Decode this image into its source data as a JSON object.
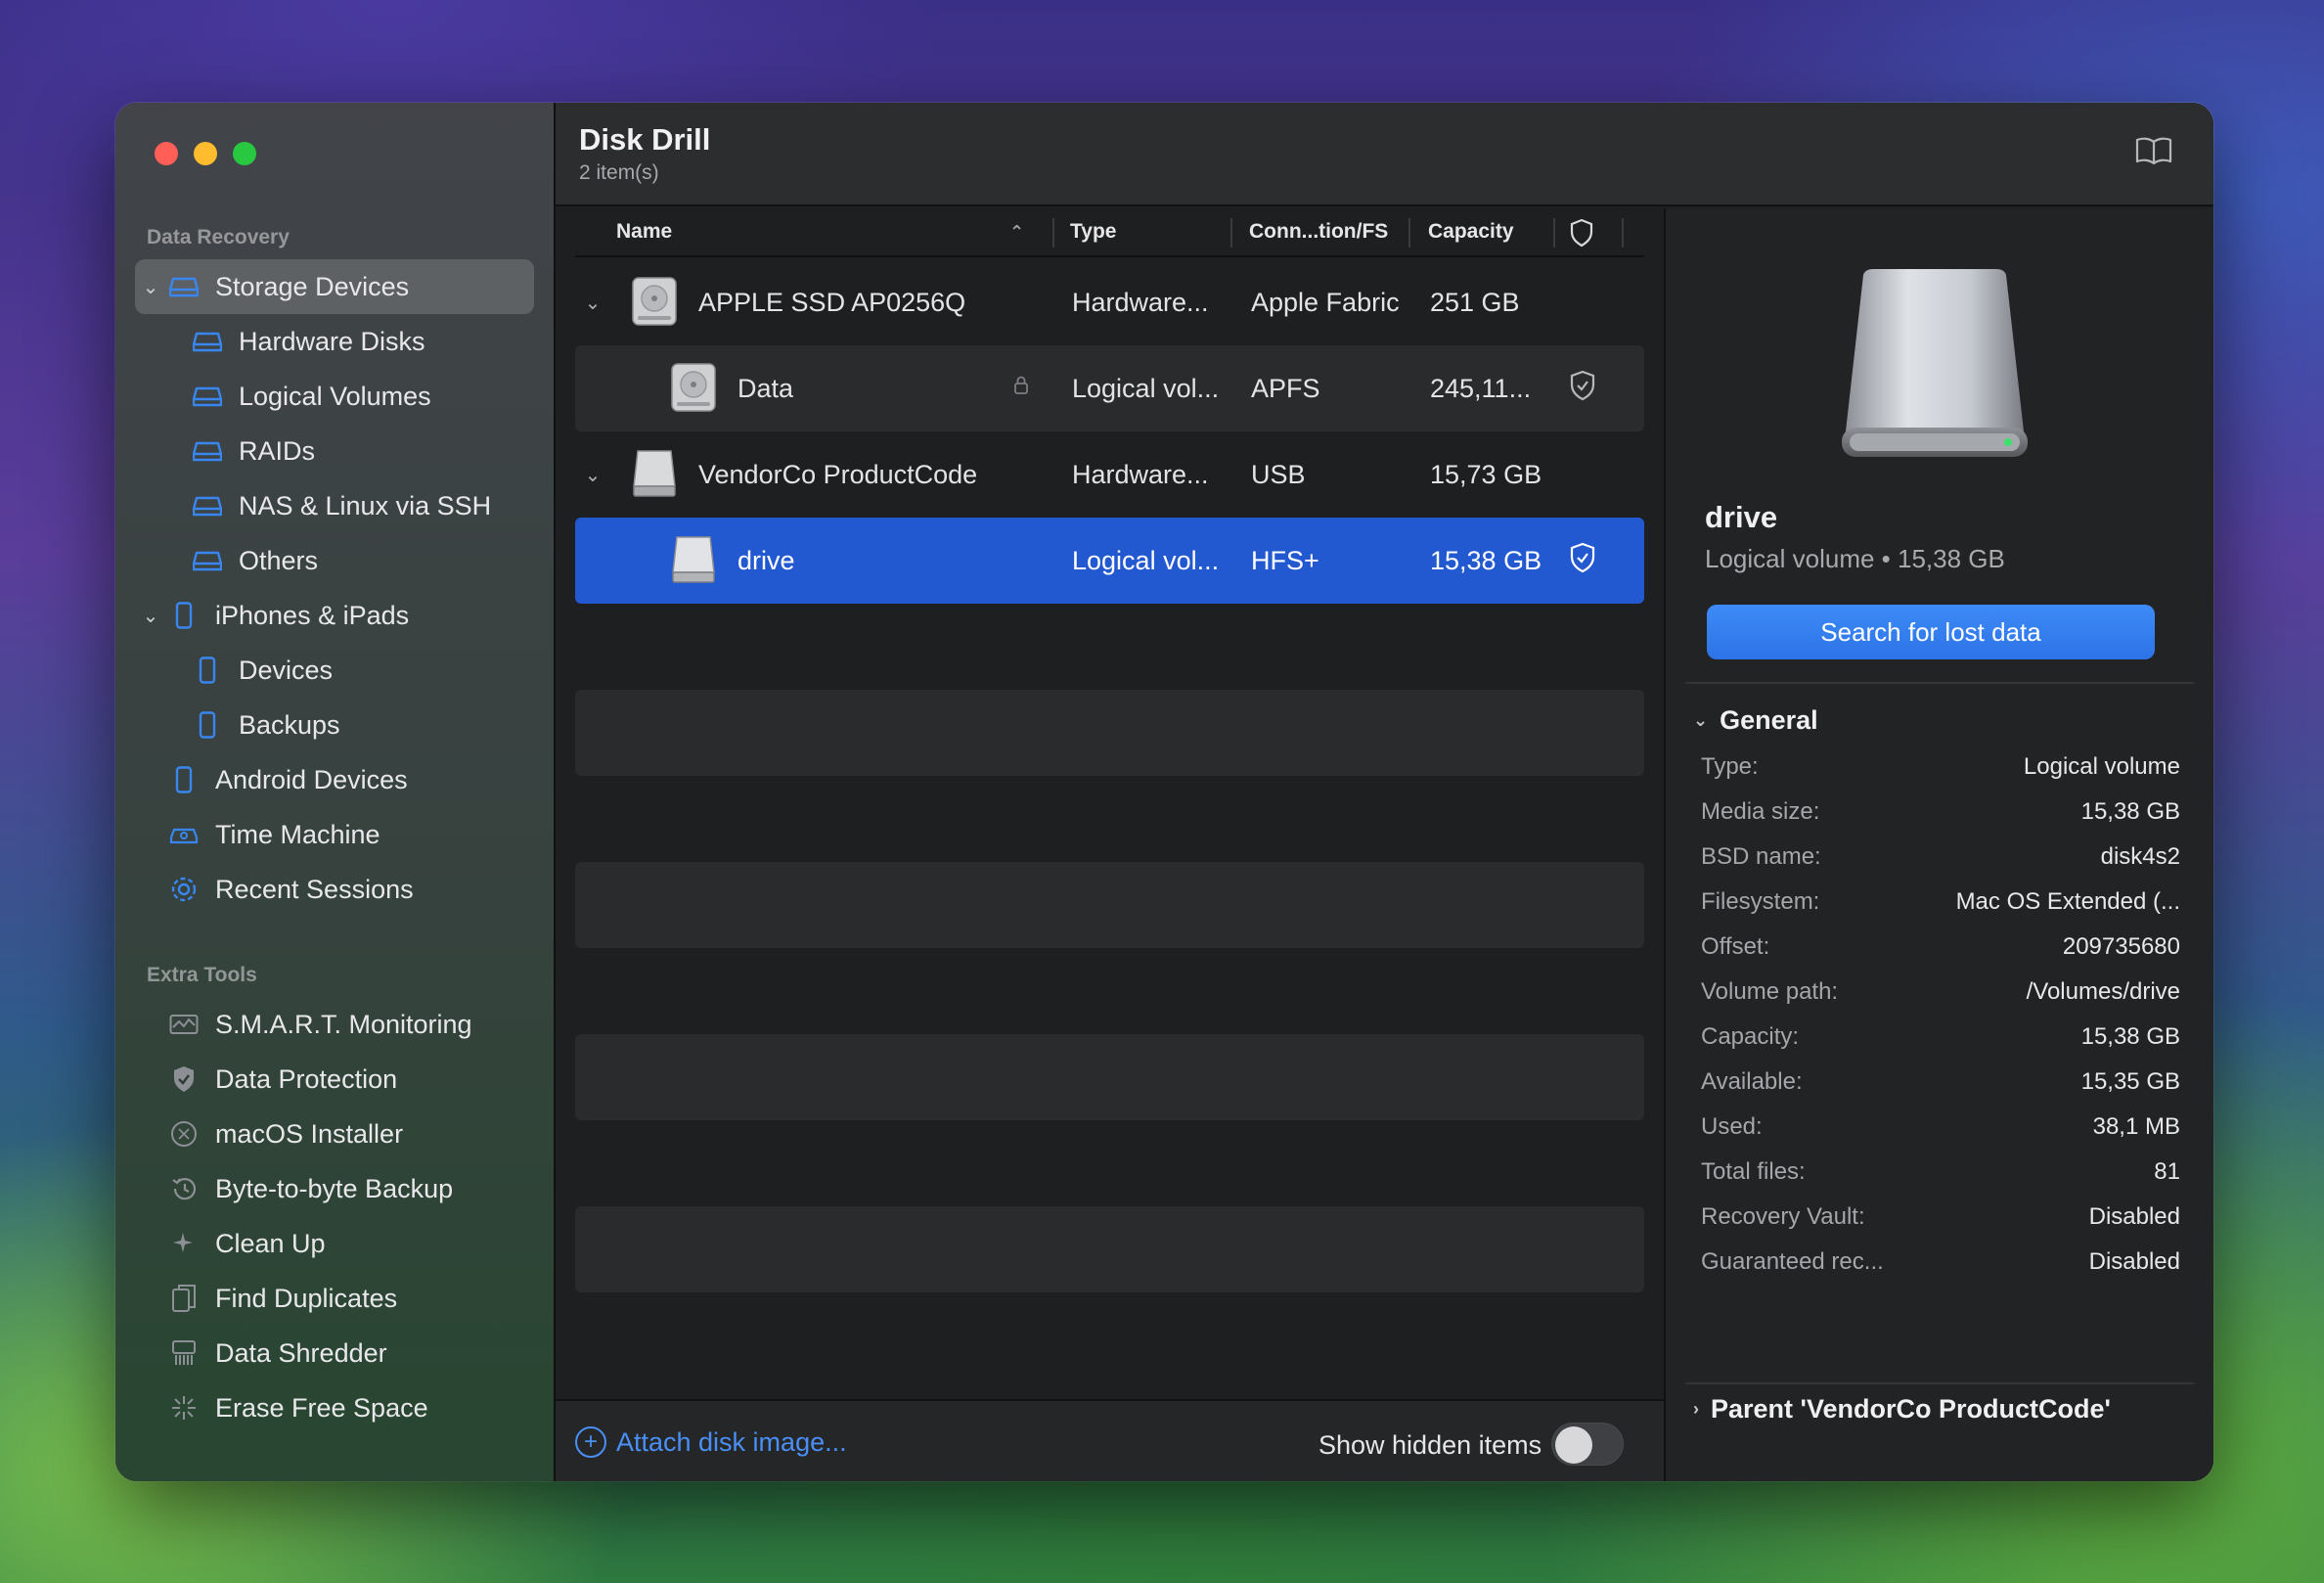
{
  "app": {
    "title": "Disk Drill",
    "subtitle": "2 item(s)"
  },
  "sidebar": {
    "section_recovery": "Data Recovery",
    "recovery_items": [
      {
        "label": "Storage Devices",
        "icon": "drive-icon"
      },
      {
        "label": "Hardware Disks",
        "icon": "drive-icon"
      },
      {
        "label": "Logical Volumes",
        "icon": "drive-icon"
      },
      {
        "label": "RAIDs",
        "icon": "drive-icon"
      },
      {
        "label": "NAS & Linux via SSH",
        "icon": "drive-icon"
      },
      {
        "label": "Others",
        "icon": "drive-icon"
      },
      {
        "label": "iPhones & iPads",
        "icon": "phone-icon"
      },
      {
        "label": "Devices",
        "icon": "phone-icon"
      },
      {
        "label": "Backups",
        "icon": "phone-icon"
      },
      {
        "label": "Android Devices",
        "icon": "phone-icon"
      },
      {
        "label": "Time Machine",
        "icon": "time-machine-icon"
      },
      {
        "label": "Recent Sessions",
        "icon": "gear-icon"
      }
    ],
    "section_tools": "Extra Tools",
    "tool_items": [
      {
        "label": "S.M.A.R.T. Monitoring",
        "icon": "monitor-icon"
      },
      {
        "label": "Data Protection",
        "icon": "shield-icon"
      },
      {
        "label": "macOS Installer",
        "icon": "installer-icon"
      },
      {
        "label": "Byte-to-byte Backup",
        "icon": "backup-icon"
      },
      {
        "label": "Clean Up",
        "icon": "sparkle-icon"
      },
      {
        "label": "Find Duplicates",
        "icon": "duplicates-icon"
      },
      {
        "label": "Data Shredder",
        "icon": "shredder-icon"
      },
      {
        "label": "Erase Free Space",
        "icon": "erase-icon"
      }
    ]
  },
  "columns": {
    "name": "Name",
    "type": "Type",
    "conn": "Conn...tion/FS",
    "capacity": "Capacity"
  },
  "rows": [
    {
      "name": "APPLE SSD AP0256Q",
      "type": "Hardware...",
      "fs": "Apple Fabric",
      "capacity": "251 GB"
    },
    {
      "name": "Data",
      "type": "Logical vol...",
      "fs": "APFS",
      "capacity": "245,11..."
    },
    {
      "name": "VendorCo ProductCode",
      "type": "Hardware...",
      "fs": "USB",
      "capacity": "15,73 GB"
    },
    {
      "name": "drive",
      "type": "Logical vol...",
      "fs": "HFS+",
      "capacity": "15,38 GB"
    }
  ],
  "footer": {
    "attach": "Attach disk image...",
    "show_hidden": "Show hidden items",
    "show_hidden_on": false
  },
  "details": {
    "name": "drive",
    "subtitle": "Logical volume • 15,38 GB",
    "search_button": "Search for lost data",
    "general_title": "General",
    "props": [
      {
        "k": "Type:",
        "v": "Logical volume"
      },
      {
        "k": "Media size:",
        "v": "15,38 GB"
      },
      {
        "k": "BSD name:",
        "v": "disk4s2"
      },
      {
        "k": "Filesystem:",
        "v": "Mac OS Extended (..."
      },
      {
        "k": "Offset:",
        "v": "209735680"
      },
      {
        "k": "Volume path:",
        "v": "/Volumes/drive"
      },
      {
        "k": "Capacity:",
        "v": "15,38 GB"
      },
      {
        "k": "Available:",
        "v": "15,35 GB"
      },
      {
        "k": "Used:",
        "v": "38,1 MB"
      },
      {
        "k": "Total files:",
        "v": "81"
      },
      {
        "k": "Recovery Vault:",
        "v": "Disabled"
      },
      {
        "k": "Guaranteed rec...",
        "v": "Disabled"
      }
    ],
    "parent": "Parent 'VendorCo ProductCode'"
  },
  "colors": {
    "accent": "#2259d1",
    "link": "#4a8ff5",
    "sidebar_icon": "#3a86f0"
  }
}
